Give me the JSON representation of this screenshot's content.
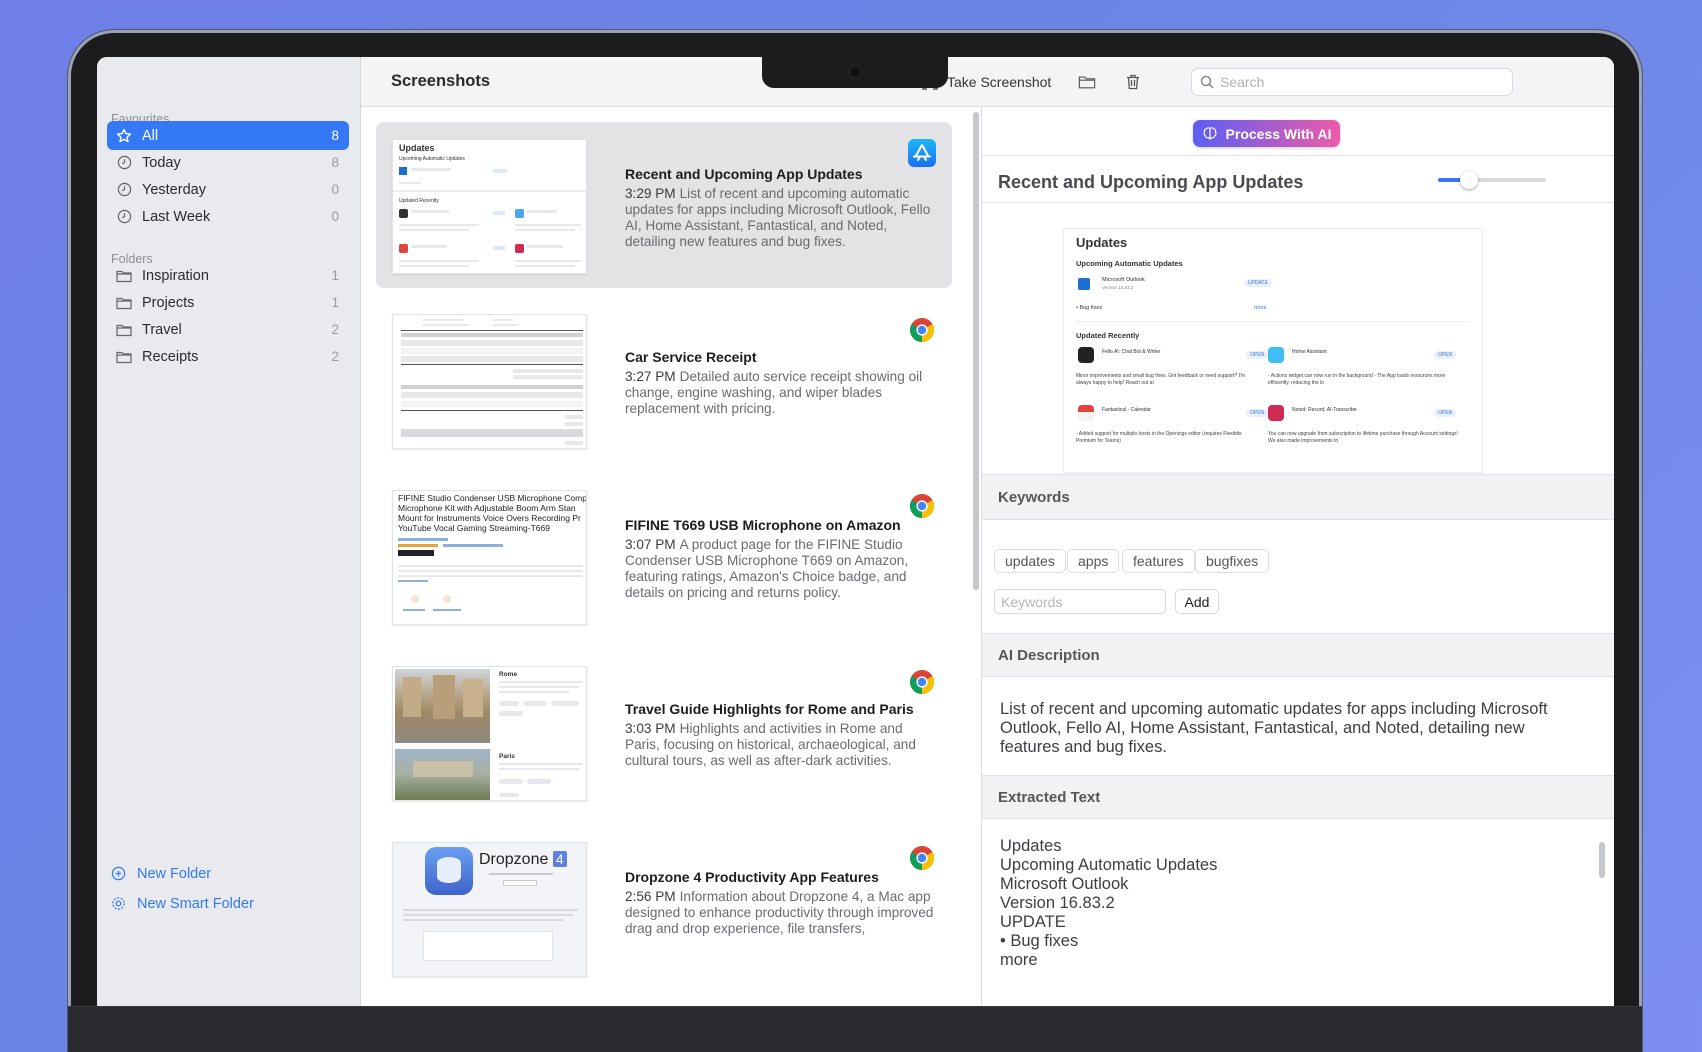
{
  "sidebar": {
    "favourites_label": "Favourites",
    "folders_label": "Folders",
    "favourites": [
      {
        "label": "All",
        "count": "8",
        "icon": "star-icon"
      },
      {
        "label": "Today",
        "count": "8",
        "icon": "clock-icon"
      },
      {
        "label": "Yesterday",
        "count": "0",
        "icon": "clock-icon"
      },
      {
        "label": "Last Week",
        "count": "0",
        "icon": "clock-icon"
      }
    ],
    "folders": [
      {
        "label": "Inspiration",
        "count": "1",
        "icon": "folder-icon"
      },
      {
        "label": "Projects",
        "count": "1",
        "icon": "folder-icon"
      },
      {
        "label": "Travel",
        "count": "2",
        "icon": "folder-icon"
      },
      {
        "label": "Receipts",
        "count": "2",
        "icon": "folder-icon"
      }
    ],
    "new_folder": "New Folder",
    "new_smart_folder": "New Smart Folder"
  },
  "toolbar": {
    "title": "Screenshots",
    "take_screenshot": "Take Screenshot",
    "search_placeholder": "Search"
  },
  "list": [
    {
      "title": "Recent and Upcoming App Updates",
      "time": "3:29 PM",
      "desc": "List of recent and upcoming automatic updates for apps including Microsoft Outlook, Fello AI, Home Assistant, Fantastical, and Noted, detailing new features and bug fixes.",
      "badge": "app-store-icon"
    },
    {
      "title": "Car Service Receipt",
      "time": "3:27 PM",
      "desc": "Detailed auto service receipt showing oil change, engine washing, and wiper blades replacement with pricing.",
      "badge": "chrome-icon"
    },
    {
      "title": "FIFINE T669 USB Microphone on Amazon",
      "time": "3:07 PM",
      "desc": "A product page for the FIFINE Studio Condenser USB Microphone T669 on Amazon, featuring ratings, Amazon's Choice badge, and details on pricing and returns policy.",
      "badge": "chrome-icon",
      "thumb_text": "FIFINE Studio Condenser USB Microphone Comp Microphone Kit with Adjustable Boom Arm Stan Mount for Instruments Voice Overs Recording Pr YouTube Vocal Gaming Streaming-T669"
    },
    {
      "title": "Travel Guide Highlights for Rome and Paris",
      "time": "3:03 PM",
      "desc": "Highlights and activities in Rome and Paris, focusing on historical, archaeological, and cultural tours, as well as after-dark activities.",
      "badge": "chrome-icon",
      "thumb_rome": "Rome",
      "thumb_paris": "Paris"
    },
    {
      "title": "Dropzone 4 Productivity App Features",
      "time": "2:56 PM",
      "desc": "Information about Dropzone 4, a Mac app designed to enhance productivity through improved drag and drop experience, file transfers,",
      "badge": "chrome-icon",
      "thumb_brand": "Dropzone",
      "thumb_version": "4"
    }
  ],
  "thumb_updates": {
    "heading": "Updates",
    "upcoming": "Upcoming Automatic Updates",
    "updated_recently": "Updated Recently"
  },
  "detail": {
    "process_button": "Process With AI",
    "title": "Recent and Upcoming App Updates",
    "preview": {
      "heading": "Updates",
      "upcoming": "Upcoming Automatic Updates",
      "app1": "Microsoft Outlook",
      "app1_version": "Version 16.83.2",
      "update_label": "UPDATE",
      "bug_fixes": "• Bug fixes",
      "more": "more",
      "updated_recently": "Updated Recently",
      "app2": "Fello AI: Chat Bot & Writer",
      "app3": "Home Assistant",
      "app4": "Fantastical - Calendar",
      "app5": "Noted: Record, AI-Transcribe",
      "open_label": "OPEN",
      "note2": "Minor improvements and small bug fixes. Got feedback or need support? I'm always happy to help! Reach out at",
      "note3": "- Actions widget can now run in the background - The App loads resources more efficiently, reducing the lo",
      "note4": "- Added support for multiple hosts in the Openings editor (requires Flexibits Premium for Teams)",
      "note5": "You can now upgrade from subscription to lifetime purchase through Account settings! We also made improvements to"
    },
    "keywords_label": "Keywords",
    "keywords": [
      "updates",
      "apps",
      "features",
      "bugfixes"
    ],
    "keyword_placeholder": "Keywords",
    "add_button": "Add",
    "ai_description_label": "AI Description",
    "ai_description": "List of recent and upcoming automatic updates for apps including Microsoft Outlook, Fello AI, Home Assistant, Fantastical, and Noted, detailing new features and bug fixes.",
    "extracted_label": "Extracted Text",
    "extracted_lines": [
      "Updates",
      "Upcoming Automatic Updates",
      "Microsoft Outlook",
      "Version 16.83.2",
      "UPDATE",
      "• Bug fixes",
      "more"
    ]
  },
  "colors": {
    "accent": "#3478f6",
    "ai_gradient_start": "#5b5ff5",
    "ai_gradient_end": "#ee5aa8"
  }
}
